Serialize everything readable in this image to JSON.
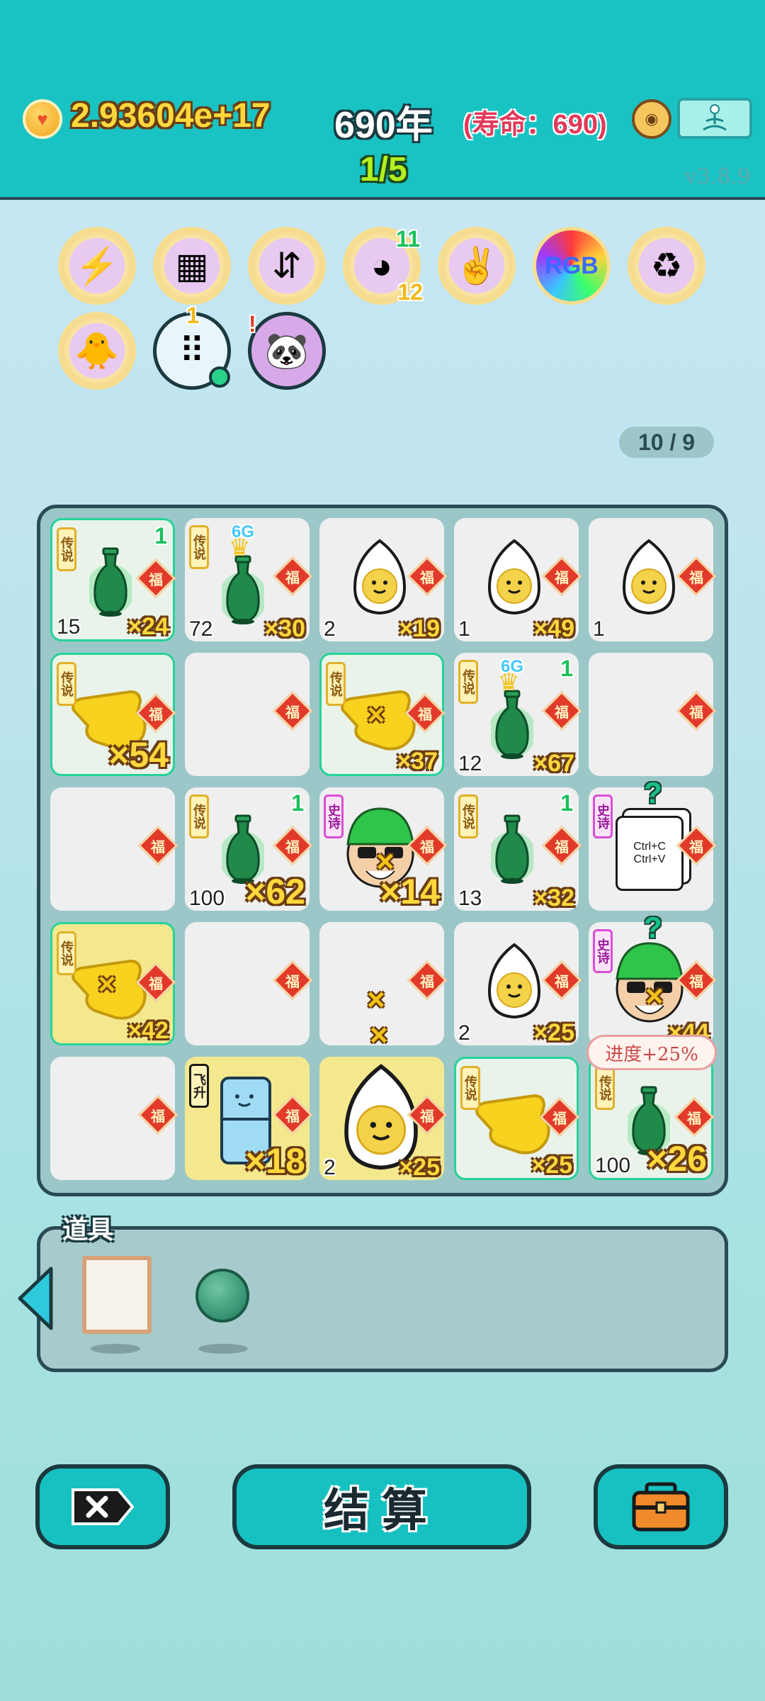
{
  "header": {
    "gold": "2.93604e+17",
    "year": "690年",
    "lifespan": "(寿命：690)",
    "round": "1/5",
    "version": "v3.8.9"
  },
  "relics": [
    {
      "name": "lightning-relic",
      "top": "",
      "bottom": ""
    },
    {
      "name": "pleated-skirt-relic",
      "top": "",
      "bottom": ""
    },
    {
      "name": "bowls-relic",
      "top": "",
      "bottom": ""
    },
    {
      "name": "shell-relic",
      "top": "11",
      "bottom": "12"
    },
    {
      "name": "rock-hand-relic",
      "top": "",
      "bottom": ""
    },
    {
      "name": "rgb-relic",
      "top": "",
      "bottom": ""
    },
    {
      "name": "recycle-relic",
      "top": "",
      "bottom": ""
    },
    {
      "name": "chick-relic",
      "top": "",
      "bottom": ""
    },
    {
      "name": "egg-tray-relic",
      "top": "1",
      "bottom": ""
    },
    {
      "name": "panda-relic",
      "top": "!",
      "bottom": ""
    }
  ],
  "rgb_label": "RGB",
  "progress": "10 / 9",
  "tags": {
    "legend": "传说",
    "epic": "史诗",
    "ascend": "飞升"
  },
  "fu": "福",
  "g6": "6G",
  "board": [
    [
      {
        "kind": "vase",
        "tag": "legend",
        "legend": true,
        "tl": "1",
        "bl": "15",
        "mult": "×24"
      },
      {
        "kind": "vase-crown",
        "tag": "legend",
        "legend": false,
        "tl": "",
        "bl": "72",
        "mult": "×30"
      },
      {
        "kind": "egg",
        "tag": "",
        "legend": false,
        "tl": "",
        "bl": "2",
        "mult": "×19"
      },
      {
        "kind": "egg",
        "tag": "",
        "legend": false,
        "tl": "",
        "bl": "1",
        "mult": "×49"
      },
      {
        "kind": "egg",
        "tag": "",
        "legend": false,
        "tl": "",
        "bl": "1",
        "mult": ""
      }
    ],
    [
      {
        "kind": "hand",
        "tag": "legend",
        "legend": true,
        "tl": "",
        "bl": "",
        "mult": "×54",
        "big": true
      },
      {
        "kind": "empty",
        "tag": "",
        "legend": false,
        "tl": "",
        "bl": "",
        "mult": ""
      },
      {
        "kind": "hand-x",
        "tag": "legend",
        "legend": true,
        "tl": "",
        "bl": "",
        "mult": "×37"
      },
      {
        "kind": "vase-crown",
        "tag": "legend",
        "legend": false,
        "tl": "1",
        "bl": "12",
        "mult": "×67"
      },
      {
        "kind": "empty",
        "tag": "",
        "legend": false,
        "tl": "",
        "bl": "",
        "mult": ""
      }
    ],
    [
      {
        "kind": "empty",
        "tag": "",
        "legend": false,
        "tl": "",
        "bl": "",
        "mult": ""
      },
      {
        "kind": "vase",
        "tag": "legend",
        "legend": false,
        "tl": "1",
        "bl": "100",
        "mult": "×62",
        "big": true
      },
      {
        "kind": "face",
        "tag": "epic",
        "legend": false,
        "tl": "",
        "bl": "",
        "mult": "×14",
        "big": true
      },
      {
        "kind": "vase",
        "tag": "legend",
        "legend": false,
        "tl": "1",
        "bl": "13",
        "mult": "×32"
      },
      {
        "kind": "ctrl",
        "tag": "epic",
        "legend": false,
        "tl": "",
        "bl": "",
        "mult": "",
        "q": true
      }
    ],
    [
      {
        "kind": "hand-x",
        "tag": "legend",
        "legend": true,
        "gold": true,
        "tl": "",
        "bl": "",
        "mult": "×42"
      },
      {
        "kind": "empty",
        "tag": "",
        "legend": false,
        "tl": "",
        "bl": "",
        "mult": ""
      },
      {
        "kind": "empty",
        "tag": "",
        "legend": false,
        "tl": "",
        "bl": "",
        "mult": ""
      },
      {
        "kind": "egg",
        "tag": "",
        "legend": false,
        "tl": "",
        "bl": "2",
        "mult": "×25"
      },
      {
        "kind": "face",
        "tag": "epic",
        "legend": false,
        "tl": "",
        "bl": "",
        "mult": "×44",
        "q": true
      }
    ],
    [
      {
        "kind": "empty",
        "tag": "",
        "legend": false,
        "tl": "",
        "bl": "",
        "mult": ""
      },
      {
        "kind": "fridge",
        "tag": "ascend",
        "legend": false,
        "gold": true,
        "tl": "",
        "bl": "",
        "mult": "×18",
        "big": true
      },
      {
        "kind": "egg-big",
        "tag": "",
        "legend": false,
        "gold": true,
        "tl": "",
        "bl": "2",
        "mult": "×25"
      },
      {
        "kind": "hand",
        "tag": "legend",
        "legend": true,
        "tl": "",
        "bl": "",
        "mult": "×25"
      },
      {
        "kind": "vase",
        "tag": "legend",
        "legend": true,
        "tl": "",
        "bl": "100",
        "mult": "×26",
        "big": true
      }
    ]
  ],
  "ctrl_lines": [
    "Ctrl+C",
    "Ctrl+V"
  ],
  "bubble": "进度+25%",
  "tools": {
    "title": "道具"
  },
  "buttons": {
    "settle": "结算"
  }
}
